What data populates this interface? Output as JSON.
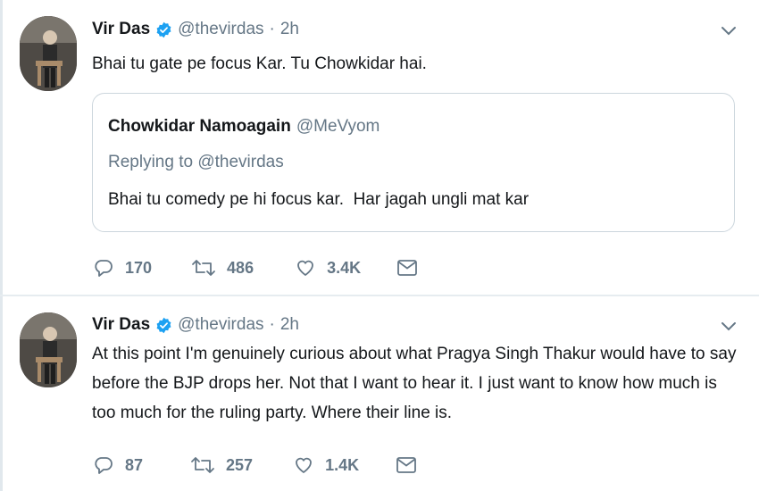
{
  "tweets": [
    {
      "name": "Vir Das",
      "handle": "@thevirdas",
      "separator": "·",
      "time": "2h",
      "text": "Bhai tu gate pe focus Kar. Tu Chowkidar hai.",
      "quote": {
        "name": "Chowkidar Namoagain",
        "handle": "@MeVyom",
        "replying": "Replying to @thevirdas",
        "text": "Bhai tu comedy pe hi focus kar.  Har jagah ungli mat kar"
      },
      "replies": "170",
      "retweets": "486",
      "likes": "3.4K"
    },
    {
      "name": "Vir Das",
      "handle": "@thevirdas",
      "separator": "·",
      "time": "2h",
      "text": "At this point I'm genuinely curious about what Pragya Singh Thakur would have to say before the BJP drops her. Not that I want to hear it. I just want to know how much is too much for the ruling party. Where their line is.",
      "replies": "87",
      "retweets": "257",
      "likes": "1.4K"
    }
  ],
  "icons": {
    "verified": "verified-badge-icon",
    "chevron": "chevron-down-icon",
    "reply": "reply-icon",
    "retweet": "retweet-icon",
    "like": "heart-icon",
    "dm": "envelope-icon"
  },
  "colors": {
    "verified": "#1da1f2",
    "secondary_text": "#657786",
    "border": "#ccd6dd"
  }
}
